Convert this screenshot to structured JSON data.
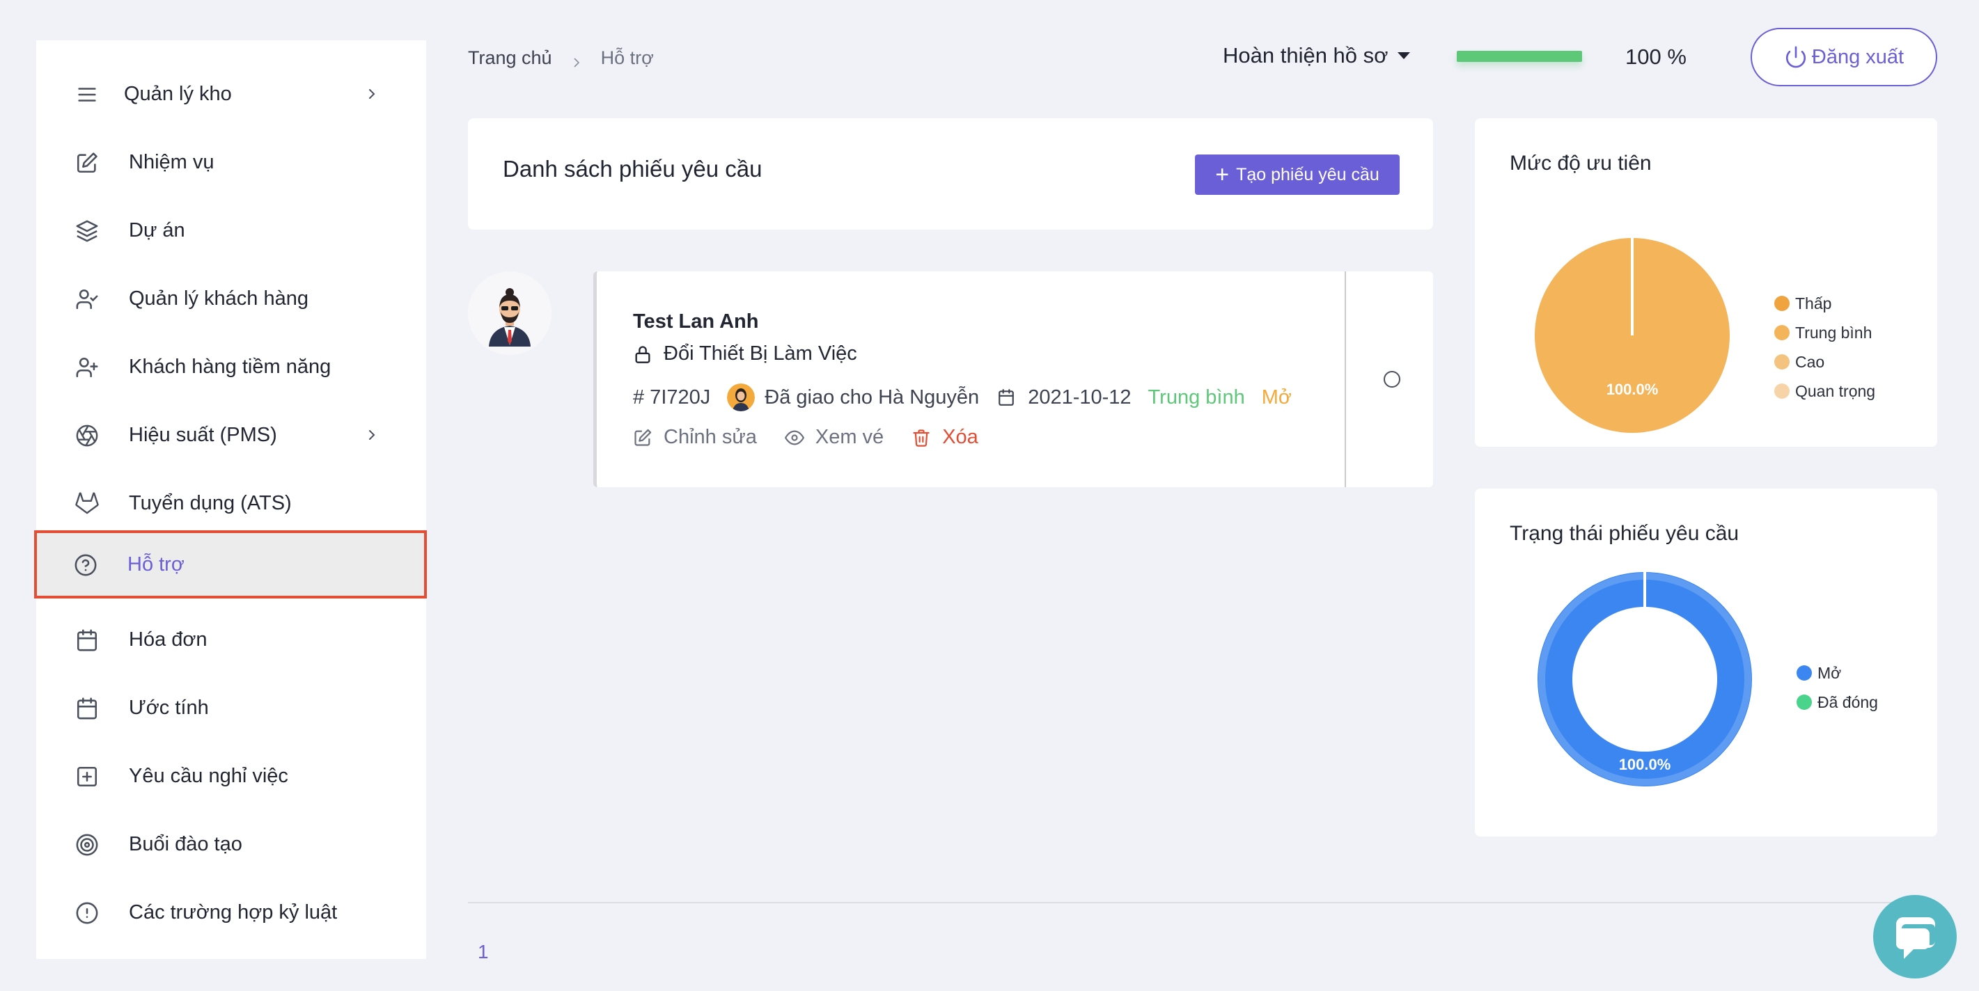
{
  "sidebar": {
    "items": [
      {
        "label": "Quản lý kho",
        "icon": "menu-icon",
        "has_submenu": true
      },
      {
        "label": "Nhiệm vụ",
        "icon": "edit-icon"
      },
      {
        "label": "Dự án",
        "icon": "layers-icon"
      },
      {
        "label": "Quản lý khách hàng",
        "icon": "user-check-icon"
      },
      {
        "label": "Khách hàng tiềm năng",
        "icon": "user-plus-icon"
      },
      {
        "label": "Hiệu suất (PMS)",
        "icon": "aperture-icon",
        "has_submenu": true
      },
      {
        "label": "Tuyển dụng (ATS)",
        "icon": "gitlab-icon"
      },
      {
        "label": "Hỗ trợ",
        "icon": "help-circle-icon",
        "active": true
      },
      {
        "label": "Hóa đơn",
        "icon": "calendar-icon"
      },
      {
        "label": "Ước tính",
        "icon": "calendar-icon"
      },
      {
        "label": "Yêu cầu nghỉ việc",
        "icon": "plus-square-icon"
      },
      {
        "label": "Buổi đào tạo",
        "icon": "target-icon"
      },
      {
        "label": "Các trường hợp kỷ luật",
        "icon": "alert-circle-icon"
      }
    ]
  },
  "header": {
    "breadcrumb": {
      "home": "Trang chủ",
      "current": "Hỗ trợ"
    },
    "profile_menu": "Hoàn thiện hồ sơ",
    "profile_progress": 100,
    "profile_progress_label": "100 %",
    "logout_label": "Đăng xuất"
  },
  "ticket_list": {
    "title": "Danh sách phiếu yêu cầu",
    "create_label": "Tạo phiếu yêu cầu"
  },
  "ticket": {
    "requester": "Test Lan Anh",
    "subject": "Đổi Thiết Bị Làm Việc",
    "code": "# 7I720J",
    "assignee": "Đã giao cho Hà Nguyễn",
    "date": "2021-10-12",
    "priority": "Trung bình",
    "status": "Mở",
    "edit_label": "Chỉnh sửa",
    "view_label": "Xem vé",
    "delete_label": "Xóa"
  },
  "pagination": {
    "page": "1"
  },
  "colors": {
    "accent": "#6a5fd6",
    "priority_green": "#5cc878",
    "status_orange": "#f3a93c",
    "danger": "#e24d33"
  },
  "chart_data": [
    {
      "type": "pie",
      "title": "Mức độ ưu tiên",
      "categories": [
        "Thấp",
        "Trung bình",
        "Cao",
        "Quan trọng"
      ],
      "values": [
        0,
        100,
        0,
        0
      ],
      "slice_label": "100.0%",
      "colors": [
        "#f0a43f",
        "#f3b45a",
        "#f4c37f",
        "#f6d4a8"
      ],
      "legend": "right"
    },
    {
      "type": "pie",
      "donut": true,
      "title": "Trạng thái phiếu yêu cầu",
      "categories": [
        "Mở",
        "Đã đóng"
      ],
      "values": [
        100,
        0
      ],
      "slice_label": "100.0%",
      "colors": [
        "#3b86f0",
        "#4ad38a"
      ],
      "legend": "right"
    }
  ]
}
